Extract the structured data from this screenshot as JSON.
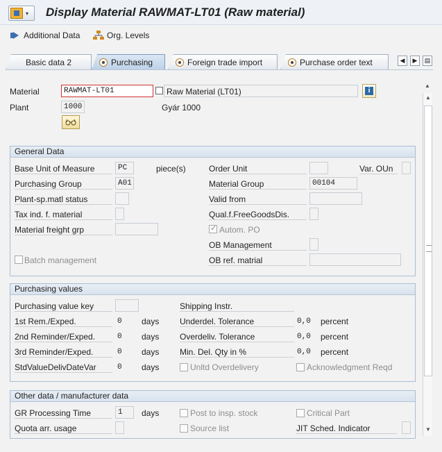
{
  "title": "Display Material RAWMAT-LT01 (Raw material)",
  "toolbar": {
    "additional_data": "Additional Data",
    "org_levels": "Org. Levels"
  },
  "tabs": [
    {
      "label": "Basic data 2"
    },
    {
      "label": "Purchasing"
    },
    {
      "label": "Foreign trade import"
    },
    {
      "label": "Purchase order text"
    }
  ],
  "header": {
    "material_label": "Material",
    "material_value": "RAWMAT-LT01",
    "material_desc": "Raw Material (LT01)",
    "plant_label": "Plant",
    "plant_value": "1000",
    "plant_desc": "Gyár 1000"
  },
  "general": {
    "title": "General Data",
    "base_uom_label": "Base Unit of Measure",
    "base_uom_value": "PC",
    "base_uom_text": "piece(s)",
    "order_unit_label": "Order Unit",
    "var_oun_label": "Var. OUn",
    "purch_group_label": "Purchasing Group",
    "purch_group_value": "A01",
    "mat_group_label": "Material Group",
    "mat_group_value": "00104",
    "plant_status_label": "Plant-sp.matl status",
    "valid_from_label": "Valid from",
    "tax_ind_label": "Tax ind. f. material",
    "qual_free_label": "Qual.f.FreeGoodsDis.",
    "freight_grp_label": "Material freight grp",
    "autom_po_label": "Autom. PO",
    "ob_mgmt_label": "OB Management",
    "batch_mgmt_label": "Batch management",
    "ob_ref_label": "OB ref. matrial"
  },
  "purchasing": {
    "title": "Purchasing values",
    "value_key_label": "Purchasing value key",
    "shipping_label": "Shipping Instr.",
    "rem1_label": "1st Rem./Exped.",
    "rem1_value": "0",
    "rem2_label": "2nd Reminder/Exped.",
    "rem2_value": "0",
    "rem3_label": "3rd Reminder/Exped.",
    "rem3_value": "0",
    "stdval_label": "StdValueDelivDateVar",
    "stdval_value": "0",
    "days": "days",
    "underdel_label": "Underdel. Tolerance",
    "underdel_value": "0,0",
    "overdel_label": "Overdeliv. Tolerance",
    "overdel_value": "0,0",
    "min_del_label": "Min. Del. Qty in %",
    "min_del_value": "0,0",
    "percent": "percent",
    "unltd_label": "Unltd Overdelivery",
    "ack_label": "Acknowledgment Reqd"
  },
  "other": {
    "title": "Other data / manufacturer data",
    "gr_time_label": "GR Processing Time",
    "gr_time_value": "1",
    "gr_days": "days",
    "post_insp_label": "Post to insp. stock",
    "critical_label": "Critical Part",
    "quota_label": "Quota arr. usage",
    "source_list_label": "Source list",
    "jit_label": "JIT Sched. Indicator"
  }
}
